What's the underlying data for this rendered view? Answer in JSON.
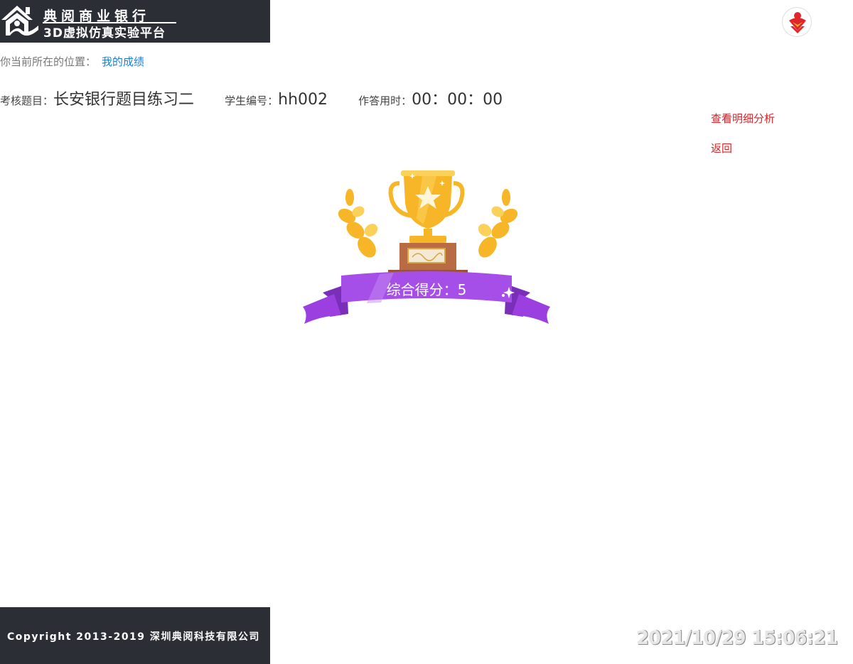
{
  "header": {
    "brand_line1": "典阅商业银行",
    "brand_line2": "3D虚拟仿真实验平台",
    "logo_icon": "house-hands-icon",
    "avatar_icon": "user-avatar-icon"
  },
  "breadcrumb": {
    "prefix": "你当前所在的位置：",
    "current": "我的成绩"
  },
  "info": {
    "exam_label": "考核题目：",
    "exam_value": "长安银行题目练习二",
    "student_label": "学生编号：",
    "student_value": "hh002",
    "time_label": "作答用时：",
    "time_value": "00：00：00"
  },
  "actions": {
    "detail_label": "查看明细分析",
    "back_label": "返回"
  },
  "result": {
    "score_text": "综合得分：5",
    "trophy_icon": "trophy-icon"
  },
  "footer": {
    "copyright": "Copyright  2013-2019  深圳典阅科技有限公司"
  },
  "clock": {
    "datetime": "2021/10/29 15:06:21"
  },
  "colors": {
    "dark_bar": "#2b2e35",
    "link_blue": "#1a7fd4",
    "action_red": "#d9262a",
    "ribbon_purple": "#9b3fe0",
    "trophy_gold": "#f6b627"
  }
}
